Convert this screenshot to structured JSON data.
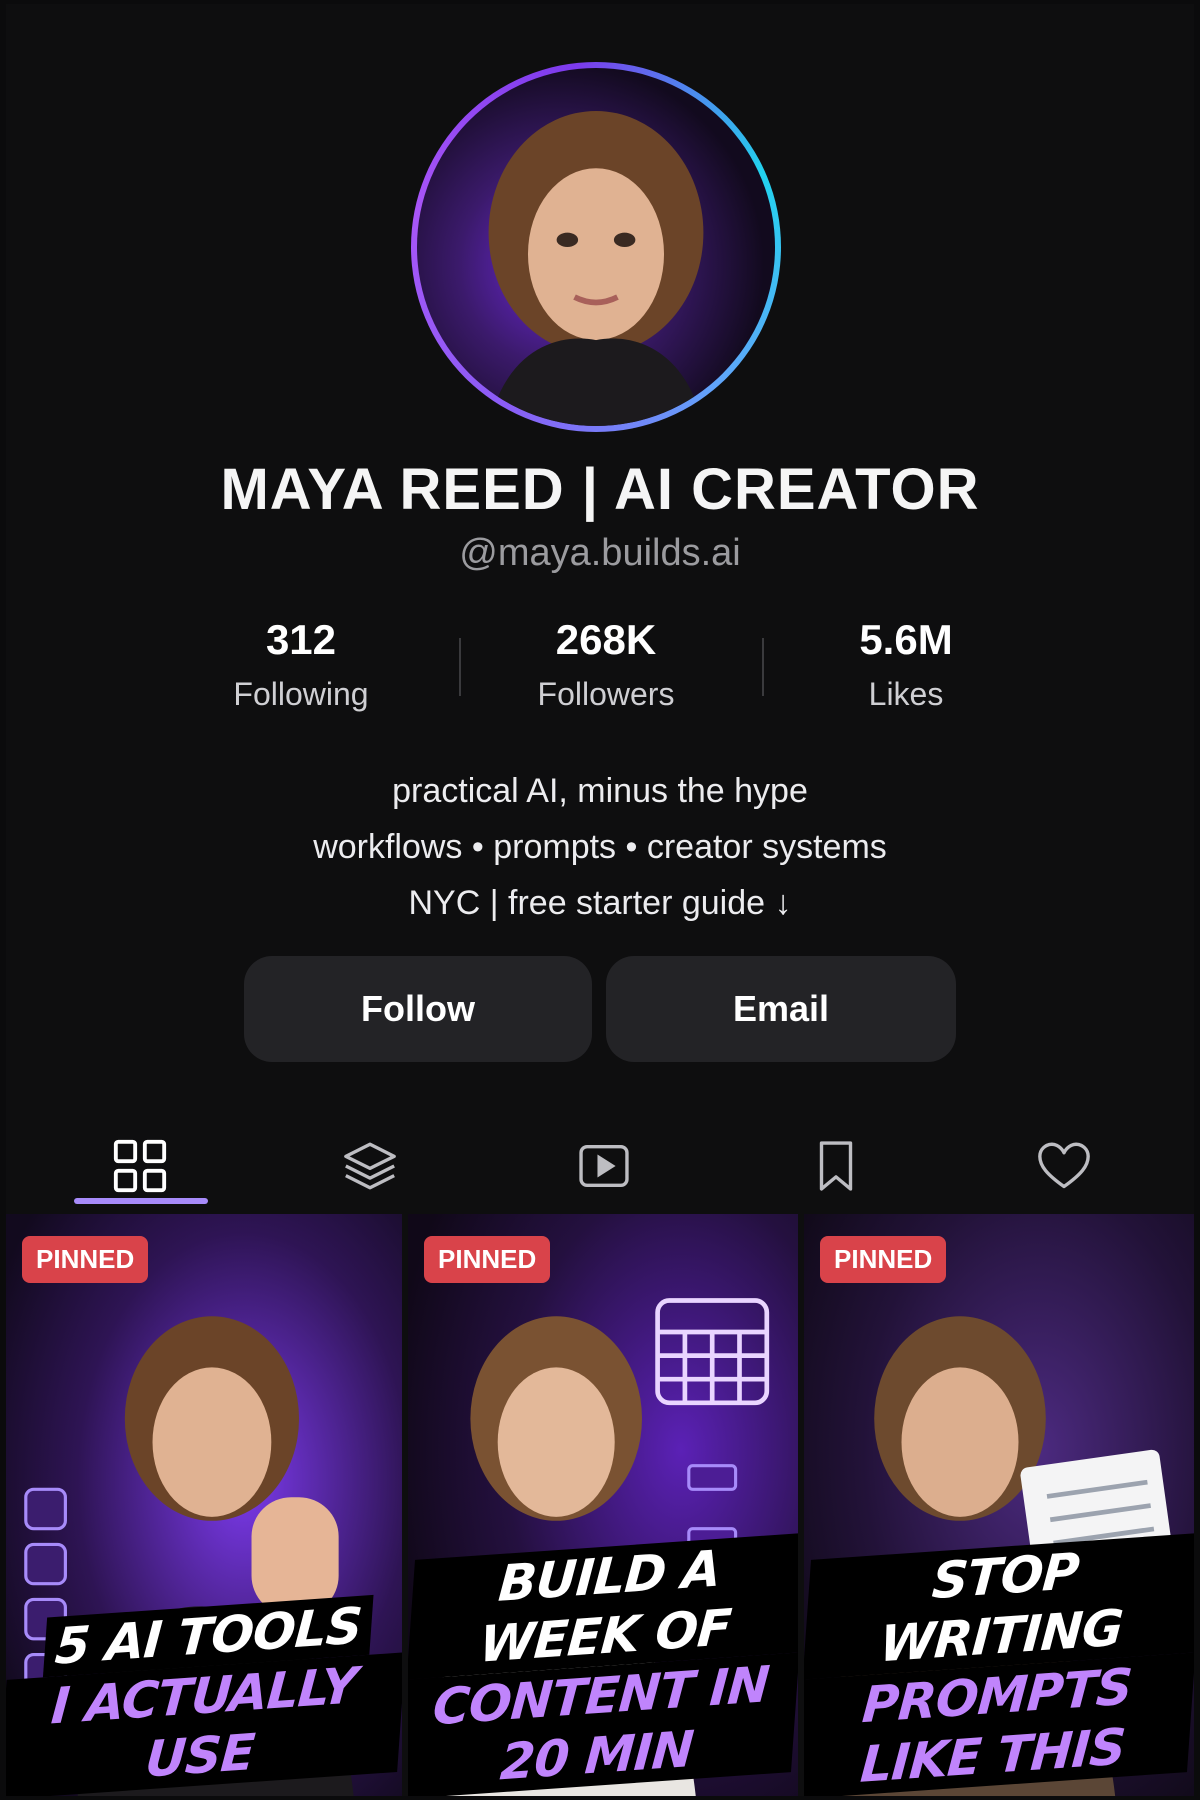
{
  "profile": {
    "name": "MAYA REED | AI CREATOR",
    "handle": "@maya.builds.ai"
  },
  "stats": [
    {
      "value": "312",
      "label": "Following"
    },
    {
      "value": "268K",
      "label": "Followers"
    },
    {
      "value": "5.6M",
      "label": "Likes"
    }
  ],
  "bio": [
    "practical AI, minus the hype",
    "workflows • prompts • creator systems",
    "NYC | free starter guide ↓"
  ],
  "actions": {
    "follow": "Follow",
    "email": "Email"
  },
  "tabs": [
    {
      "icon": "grid-icon"
    },
    {
      "icon": "layers-icon"
    },
    {
      "icon": "play-icon"
    },
    {
      "icon": "bookmark-icon"
    },
    {
      "icon": "heart-icon"
    }
  ],
  "videos": [
    {
      "badge": "PINNED",
      "line1": "5 AI TOOLS",
      "line2": "I ACTUALLY USE"
    },
    {
      "badge": "PINNED",
      "line1": "BUILD A WEEK OF",
      "line2": "CONTENT IN 20 MIN"
    },
    {
      "badge": "PINNED",
      "line1": "STOP WRITING",
      "line2": "PROMPTS LIKE THIS"
    }
  ],
  "colors": {
    "accent": "#a78bfa",
    "badge": "#d9434a",
    "caption_highlight": "#c084fc"
  }
}
